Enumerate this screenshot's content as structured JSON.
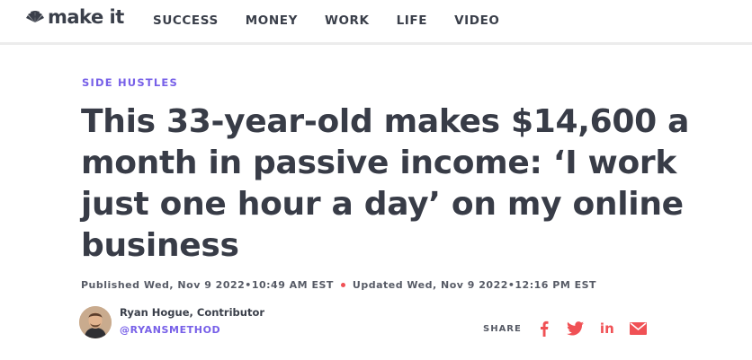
{
  "brand": {
    "logo_text": "make it"
  },
  "nav": {
    "items": [
      {
        "label": "SUCCESS"
      },
      {
        "label": "MONEY"
      },
      {
        "label": "WORK"
      },
      {
        "label": "LIFE"
      },
      {
        "label": "VIDEO"
      }
    ]
  },
  "article": {
    "section": "SIDE HUSTLES",
    "headline": "This 33-year-old makes $14,600 a month in passive income: ‘I work just one hour a day’ on my online business",
    "published": "Published Wed, Nov 9 2022•10:49 AM EST",
    "updated": "Updated Wed, Nov 9 2022•12:16 PM EST"
  },
  "author": {
    "name": "Ryan Hogue, Contributor",
    "handle": "@RYANSMETHOD"
  },
  "share": {
    "label": "SHARE",
    "buttons": [
      {
        "icon": "facebook-icon"
      },
      {
        "icon": "twitter-icon"
      },
      {
        "icon": "linkedin-icon",
        "text": "in"
      },
      {
        "icon": "email-icon"
      }
    ]
  },
  "colors": {
    "accent": "#7760e8",
    "share": "#f05155",
    "text": "#383c47"
  }
}
